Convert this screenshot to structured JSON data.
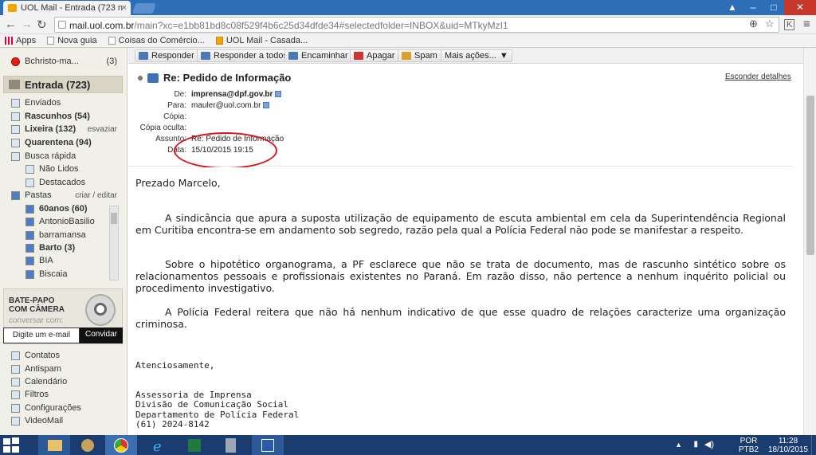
{
  "browser": {
    "tab_title": "UOL Mail - Entrada (723 n",
    "tab_close": "×",
    "url_host": "mail.uol.com.br",
    "url_path": "/main?xc=e1bb81bd8c08f529f4b6c25d34dfde34#selectedfolder=INBOX&uid=MTkyMzI1",
    "bookmarks": [
      "Apps",
      "Nova guia",
      "Coisas do Comércio...",
      "UOL Mail - Casada..."
    ]
  },
  "sidebar": {
    "top_item": {
      "label": "Bchristo-ma...",
      "count": "(3)"
    },
    "inbox_label": "Entrada (723)",
    "items": [
      {
        "label": "Enviados"
      },
      {
        "label": "Rascunhos (54)"
      },
      {
        "label": "Lixeira (132)",
        "action": "esvaziar"
      },
      {
        "label": "Quarentena (94)"
      },
      {
        "label": "Busca rápida"
      },
      {
        "label": "Não Lidos"
      },
      {
        "label": "Destacados"
      },
      {
        "label": "Pastas",
        "action": "criar / editar"
      }
    ],
    "folders": [
      {
        "label": "60anos (60)"
      },
      {
        "label": "AntonioBasilio"
      },
      {
        "label": "barramansa"
      },
      {
        "label": "Barto (3)"
      },
      {
        "label": "BIA"
      },
      {
        "label": "Biscaia"
      }
    ],
    "chat": {
      "title_line1": "BATE-PAPO",
      "title_line2": "COM CÂMERA",
      "subtitle": "conversar com:",
      "input_placeholder": "Digite um e-mail",
      "button": "Convidar"
    },
    "tools": [
      {
        "label": "Contatos"
      },
      {
        "label": "Antispam"
      },
      {
        "label": "Calendário"
      },
      {
        "label": "Filtros"
      },
      {
        "label": "Configurações"
      },
      {
        "label": "VideoMail"
      }
    ]
  },
  "toolbar": {
    "reply": "Responder",
    "reply_all": "Responder a todos",
    "forward": "Encaminhar",
    "delete": "Apagar",
    "spam": "Spam",
    "more": "Mais ações..."
  },
  "message": {
    "subject": "Re: Pedido de Informação",
    "hide_details": "Esconder detalhes",
    "labels": {
      "from": "De:",
      "to": "Para:",
      "cc": "Cópia:",
      "bcc": "Cópia oculta:",
      "subject": "Assunto:",
      "date": "Data:"
    },
    "from": "imprensa@dpf.gov.br",
    "to": "mauler@uol.com.br",
    "subject_value": "Re: Pedido de Informação",
    "date": "15/10/2015 19:15",
    "greeting": "Prezado Marcelo,",
    "paragraphs": [
      "A sindicância que apura a suposta utilização de equipamento de escuta ambiental em cela da Superintendência Regional em Curitiba encontra-se em andamento sob segredo, razão pela qual a Polícia Federal não pode se manifestar a respeito.",
      "Sobre o hipotético organograma, a PF esclarece que não se trata de documento, mas de rascunho sintético sobre os relacionamentos pessoais e profissionais existentes no Paraná. Em razão disso, não pertence a nenhum inquérito policial ou procedimento investigativo.",
      "A Polícia Federal reitera que não há nenhum indicativo de que esse quadro de relações caracterize uma organização criminosa."
    ],
    "closing": "Atenciosamente,",
    "signature": [
      "Assessoria de Imprensa",
      "Divisão de Comunicação Social",
      "Departamento de Polícia Federal",
      "(61) 2024-8142"
    ]
  },
  "taskbar": {
    "lang": "POR",
    "lang2": "PTB2",
    "time": "11:28",
    "date": "18/10/2015"
  }
}
